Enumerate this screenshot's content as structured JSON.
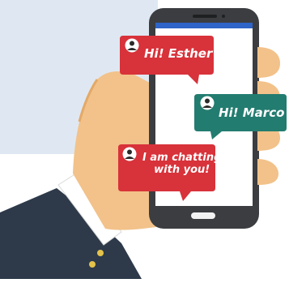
{
  "illustration": {
    "colors": {
      "background_panel": "#dfe8f2",
      "skin": "#f2c28a",
      "skin_shadow": "#e4a968",
      "sleeve": "#2e3a4a",
      "cuff": "#ffffff",
      "button": "#e4c34a",
      "phone_body": "#3b3d40",
      "phone_screen": "#ffffff",
      "app_bar": "#2f64c8",
      "red_bubble": "#d8323a",
      "teal_bubble": "#237c70",
      "avatar": "#2a2a2a"
    },
    "messages": [
      {
        "side": "left",
        "lines": [
          "Hi! Esther"
        ],
        "color": "red"
      },
      {
        "side": "right",
        "lines": [
          "Hi! Marco"
        ],
        "color": "teal"
      },
      {
        "side": "left",
        "lines": [
          "I am chatting",
          "with you!"
        ],
        "color": "red"
      }
    ]
  }
}
